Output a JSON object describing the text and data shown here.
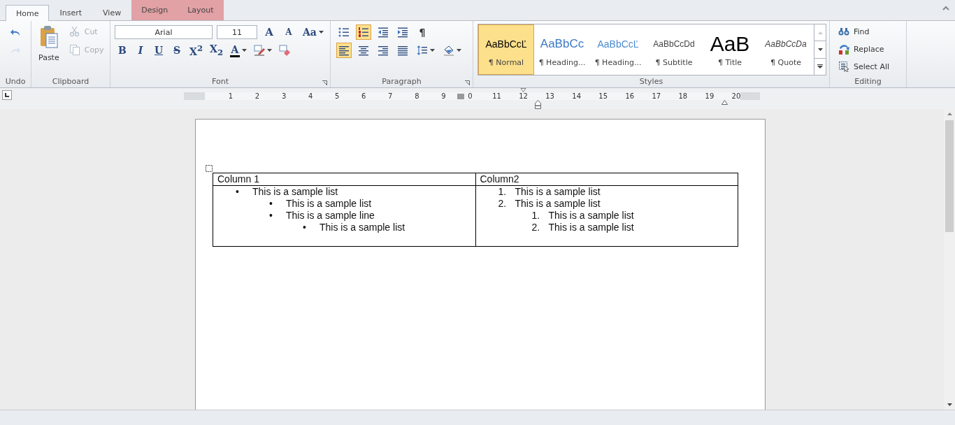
{
  "tabs": [
    {
      "label": "Home",
      "selected": true,
      "kind": "main"
    },
    {
      "label": "Insert",
      "selected": false,
      "kind": "main"
    },
    {
      "label": "View",
      "selected": false,
      "kind": "main"
    },
    {
      "label": "Design",
      "selected": false,
      "kind": "contextual"
    },
    {
      "label": "Layout",
      "selected": false,
      "kind": "contextual"
    }
  ],
  "ribbon": {
    "undo": {
      "label": "Undo",
      "buttons": [
        {
          "kind": "undo",
          "disabled": false
        },
        {
          "kind": "redo",
          "disabled": true
        }
      ]
    },
    "clipboard": {
      "label": "Clipboard",
      "paste": "Paste",
      "buttons": [
        {
          "kind": "cut",
          "label": "Cut",
          "disabled": true
        },
        {
          "kind": "copy",
          "label": "Copy",
          "disabled": true
        }
      ]
    },
    "font": {
      "label": "Font",
      "name": "Arial",
      "size": "11",
      "row1": [
        {
          "kind": "grow",
          "glyph": "A"
        },
        {
          "kind": "shrink",
          "glyph": "A"
        },
        {
          "kind": "case",
          "glyph": "Aa",
          "dropdown": true
        }
      ],
      "row2": [
        {
          "kind": "bold",
          "glyph": "B"
        },
        {
          "kind": "italic",
          "glyph": "I"
        },
        {
          "kind": "underline",
          "glyph": "U"
        },
        {
          "kind": "strike",
          "glyph": "S"
        },
        {
          "kind": "superscript",
          "glyph": "X$^{2}$"
        },
        {
          "kind": "subscript",
          "glyph": "X$_{2}$"
        },
        {
          "kind": "font-color",
          "glyph": "A",
          "dropdown": true
        },
        {
          "kind": "highlight",
          "dropdown": true
        },
        {
          "kind": "clear-format"
        }
      ]
    },
    "paragraph": {
      "label": "Paragraph",
      "row1": [
        {
          "kind": "bullets",
          "selected": false
        },
        {
          "kind": "numbering",
          "selected": true
        },
        {
          "kind": "outdent",
          "selected": false
        },
        {
          "kind": "indent",
          "selected": false
        },
        {
          "kind": "pilcrow",
          "glyph": "¶",
          "selected": false
        }
      ],
      "row2": [
        {
          "kind": "align-left",
          "selected": true
        },
        {
          "kind": "align-center",
          "selected": false
        },
        {
          "kind": "align-right",
          "selected": false
        },
        {
          "kind": "justify",
          "selected": false
        },
        {
          "kind": "line-spacing",
          "selected": false,
          "dropdown": true
        },
        {
          "kind": "shading",
          "selected": false,
          "dropdown": true
        }
      ]
    },
    "styles": {
      "label": "Styles",
      "items": [
        {
          "kind": "normal",
          "preview": "AaBbCcĽ",
          "name": "¶ Normal",
          "selected": true
        },
        {
          "kind": "heading1",
          "preview": "AaBbCc",
          "name": "¶ Heading...",
          "selected": false
        },
        {
          "kind": "heading2",
          "preview": "AaBbCcĽ",
          "name": "¶ Heading...",
          "selected": false
        },
        {
          "kind": "subtitle",
          "preview": "AaBbCcDd",
          "name": "¶ Subtitle",
          "selected": false
        },
        {
          "kind": "title",
          "preview": "AaB",
          "name": "¶ Title",
          "selected": false
        },
        {
          "kind": "quote",
          "preview": "AaBbCcDa",
          "name": "¶ Quote",
          "selected": false
        }
      ]
    },
    "editing": {
      "label": "Editing",
      "buttons": [
        {
          "kind": "find",
          "label": "Find"
        },
        {
          "kind": "replace",
          "label": "Replace"
        },
        {
          "kind": "select-all",
          "label": "Select All"
        }
      ]
    }
  },
  "ruler": [
    "1",
    "2",
    "3",
    "4",
    "5",
    "6",
    "7",
    "8",
    "9",
    "0",
    "11",
    "12",
    "13",
    "14",
    "15",
    "16",
    "17",
    "18",
    "19",
    "20"
  ],
  "table": {
    "columns": [
      "Column 1",
      "Column2"
    ],
    "cells": [
      [
        {
          "marker": "•",
          "text": "This is a sample list",
          "children": [
            {
              "marker": "•",
              "text": "This is a sample list"
            },
            {
              "marker": "•",
              "text": "This is a sample line",
              "children": [
                {
                  "marker": "•",
                  "text": "This is a sample list"
                }
              ]
            }
          ]
        }
      ],
      [
        {
          "marker": "1.",
          "text": "This is a sample list"
        },
        {
          "marker": "2.",
          "text": "This is a sample list",
          "children": [
            {
              "marker": "1.",
              "text": "This is a sample list"
            },
            {
              "marker": "2.",
              "text": "This is a sample list"
            }
          ]
        }
      ]
    ]
  }
}
